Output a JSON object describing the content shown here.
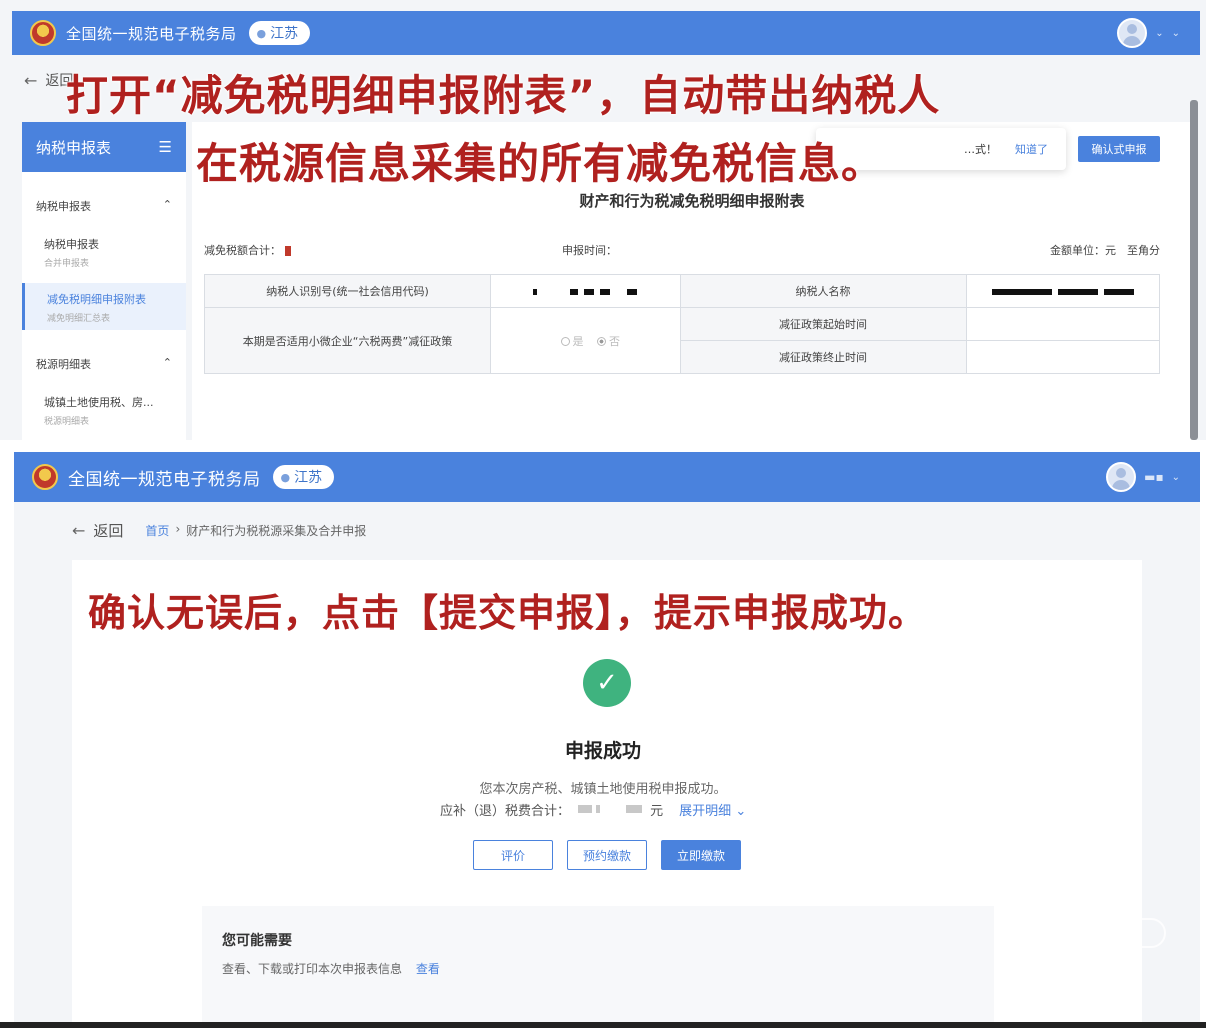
{
  "top_screen": {
    "header": {
      "site_title": "全国统一规范电子税务局",
      "region": "江苏"
    },
    "back_label": "返回",
    "sidebar": {
      "title": "纳税申报表",
      "groups": [
        {
          "label": "纳税申报表",
          "items": [
            {
              "label": "纳税申报表",
              "sub": "合并申报表"
            },
            {
              "label": "减免税明细申报附表",
              "sub": "减免明细汇总表"
            }
          ]
        },
        {
          "label": "税源明细表",
          "items": [
            {
              "label": "城镇土地使用税、房...",
              "sub": "税源明细表"
            }
          ]
        }
      ]
    },
    "toast": {
      "message": "…式！",
      "ok": "知道了"
    },
    "confirm_button": "确认式申报",
    "form": {
      "title": "财产和行为税减免税明细申报附表",
      "total_label": "减免税额合计：",
      "date_label": "申报时间：",
      "unit_label": "金额单位：元　至角分",
      "table": {
        "taxpayer_id_label": "纳税人识别号(统一社会信用代码)",
        "taxpayer_name_label": "纳税人名称",
        "policy_label": "本期是否适用小微企业“六税两费”减征政策",
        "radio_yes": "是",
        "radio_no": "否",
        "start_label": "减征政策起始时间",
        "end_label": "减征政策终止时间"
      }
    }
  },
  "captions": {
    "line1": "打开“减免税明细申报附表”，自动带出纳税人",
    "line2": "在税源信息采集的所有减免税信息。",
    "line3": "确认无误后，点击【提交申报】，提示申报成功。"
  },
  "bottom_screen": {
    "header": {
      "site_title": "全国统一规范电子税务局",
      "region": "江苏"
    },
    "back_label": "返回",
    "breadcrumb": {
      "home": "首页",
      "current": "财产和行为税税源采集及合并申报"
    },
    "success": {
      "title": "申报成功",
      "message": "您本次房产税、城镇土地使用税申报成功。",
      "tax_label": "应补（退）税费合计：",
      "currency": "元",
      "expand_label": "展开明细"
    },
    "buttons": {
      "evaluate": "评价",
      "schedule_pay": "预约缴款",
      "pay_now": "立即缴款"
    },
    "need": {
      "title": "您可能需要",
      "desc": "查看、下载或打印本次申报表信息",
      "view": "查看"
    }
  }
}
